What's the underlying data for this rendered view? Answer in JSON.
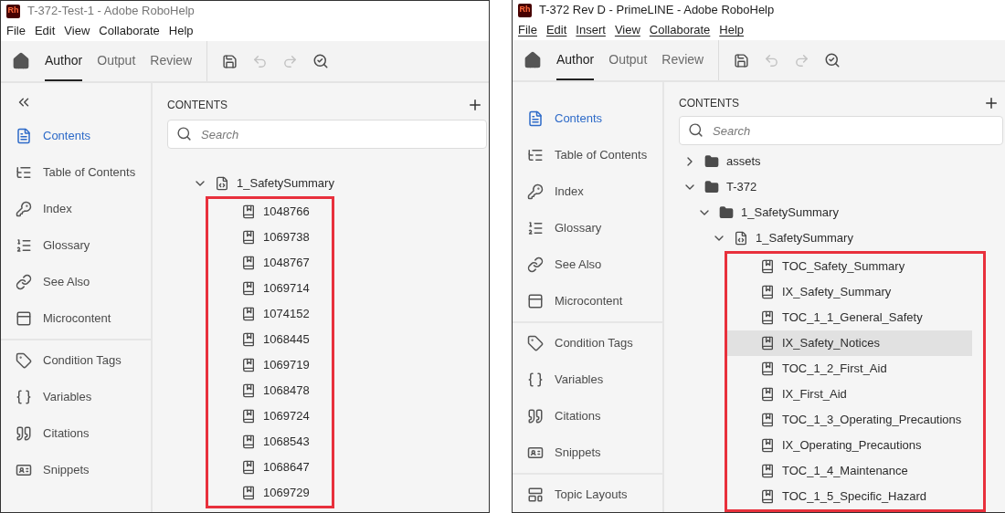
{
  "windows": [
    {
      "app_badge": "Rh",
      "title": "T-372-Test-1 - Adobe RoboHelp",
      "menu_mnemonics": false,
      "menu": [
        "File",
        "Edit",
        "View",
        "Collaborate",
        "Help"
      ],
      "tabs": [
        {
          "label": "Author",
          "selected": true
        },
        {
          "label": "Output",
          "selected": false
        },
        {
          "label": "Review",
          "selected": false
        }
      ],
      "sidebar": [
        [
          {
            "label": "Contents",
            "selected": true
          },
          {
            "label": "Table of Contents",
            "selected": false
          },
          {
            "label": "Index",
            "selected": false
          },
          {
            "label": "Glossary",
            "selected": false
          },
          {
            "label": "See Also",
            "selected": false
          },
          {
            "label": "Microcontent",
            "selected": false
          }
        ],
        [
          {
            "label": "Condition Tags",
            "selected": false
          },
          {
            "label": "Variables",
            "selected": false
          },
          {
            "label": "Citations",
            "selected": false
          },
          {
            "label": "Snippets",
            "selected": false
          }
        ]
      ],
      "contents": {
        "title": "CONTENTS",
        "search_placeholder": "Search",
        "tree": [
          {
            "label": "1_SafetySummary",
            "kind": "topic",
            "expanded": true,
            "selected": false,
            "boxed": true,
            "children": [
              {
                "label": "1048766",
                "kind": "toc",
                "selected": false
              },
              {
                "label": "1069738",
                "kind": "toc",
                "selected": false
              },
              {
                "label": "1048767",
                "kind": "toc",
                "selected": false
              },
              {
                "label": "1069714",
                "kind": "toc",
                "selected": false
              },
              {
                "label": "1074152",
                "kind": "toc",
                "selected": false
              },
              {
                "label": "1068445",
                "kind": "toc",
                "selected": false
              },
              {
                "label": "1069719",
                "kind": "toc",
                "selected": false
              },
              {
                "label": "1068478",
                "kind": "toc",
                "selected": false
              },
              {
                "label": "1069724",
                "kind": "toc",
                "selected": false
              },
              {
                "label": "1068543",
                "kind": "toc",
                "selected": false
              },
              {
                "label": "1068647",
                "kind": "toc",
                "selected": false
              },
              {
                "label": "1069729",
                "kind": "toc",
                "selected": false
              }
            ]
          }
        ]
      }
    },
    {
      "app_badge": "Rh",
      "title": "T-372 Rev D - PrimeLINE - Adobe RoboHelp",
      "menu_mnemonics": true,
      "menu": [
        "File",
        "Edit",
        "Insert",
        "View",
        "Collaborate",
        "Help"
      ],
      "tabs": [
        {
          "label": "Author",
          "selected": true
        },
        {
          "label": "Output",
          "selected": false
        },
        {
          "label": "Review",
          "selected": false
        }
      ],
      "sidebar": [
        [
          {
            "label": "Contents",
            "selected": true
          },
          {
            "label": "Table of Contents",
            "selected": false
          },
          {
            "label": "Index",
            "selected": false
          },
          {
            "label": "Glossary",
            "selected": false
          },
          {
            "label": "See Also",
            "selected": false
          },
          {
            "label": "Microcontent",
            "selected": false
          }
        ],
        [
          {
            "label": "Condition Tags",
            "selected": false
          },
          {
            "label": "Variables",
            "selected": false
          },
          {
            "label": "Citations",
            "selected": false
          },
          {
            "label": "Snippets",
            "selected": false
          }
        ],
        [
          {
            "label": "Topic Layouts",
            "selected": false
          }
        ]
      ],
      "contents": {
        "title": "CONTENTS",
        "search_placeholder": "Search",
        "tree": [
          {
            "label": "assets",
            "kind": "folder",
            "expanded": false,
            "selected": false
          },
          {
            "label": "T-372",
            "kind": "folder",
            "expanded": true,
            "selected": false,
            "children": [
              {
                "label": "1_SafetySummary",
                "kind": "folder",
                "expanded": true,
                "selected": false,
                "children": [
                  {
                    "label": "1_SafetySummary",
                    "kind": "topic",
                    "expanded": true,
                    "selected": false,
                    "boxed": true,
                    "children": [
                      {
                        "label": "TOC_Safety_Summary",
                        "kind": "toc",
                        "selected": false
                      },
                      {
                        "label": "IX_Safety_Summary",
                        "kind": "toc",
                        "selected": false
                      },
                      {
                        "label": "TOC_1_1_General_Safety",
                        "kind": "toc",
                        "selected": false
                      },
                      {
                        "label": "IX_Safety_Notices",
                        "kind": "toc",
                        "selected": true
                      },
                      {
                        "label": "TOC_1_2_First_Aid",
                        "kind": "toc",
                        "selected": false
                      },
                      {
                        "label": "IX_First_Aid",
                        "kind": "toc",
                        "selected": false
                      },
                      {
                        "label": "TOC_1_3_Operating_Precautions",
                        "kind": "toc",
                        "selected": false
                      },
                      {
                        "label": "IX_Operating_Precautions",
                        "kind": "toc",
                        "selected": false
                      },
                      {
                        "label": "TOC_1_4_Maintenance",
                        "kind": "toc",
                        "selected": false
                      },
                      {
                        "label": "TOC_1_5_Specific_Hazard",
                        "kind": "toc",
                        "selected": false
                      }
                    ]
                  }
                ]
              }
            ]
          }
        ]
      }
    }
  ]
}
